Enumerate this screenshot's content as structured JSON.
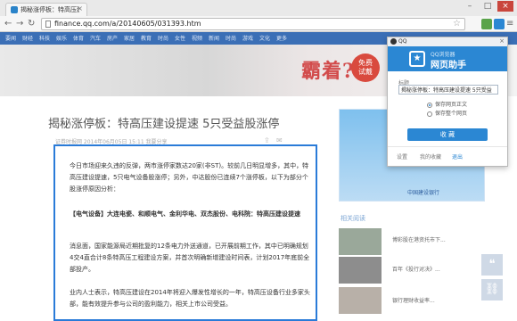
{
  "browser": {
    "tab_title": "揭秘涨停板：特高压建设...",
    "tab_close": "×",
    "url": "finance.qq.com/a/20140605/031393.htm",
    "win_min": "–",
    "win_max": "□",
    "win_close": "×"
  },
  "site_nav": [
    "要闻",
    "财经",
    "科技",
    "娱乐",
    "体育",
    "汽车",
    "房产",
    "家居",
    "教育",
    "时尚",
    "女性",
    "视频",
    "新闻",
    "时尚",
    "游戏",
    "文化",
    "更多"
  ],
  "banner": {
    "ad_text": "霸着?",
    "badge": "免费\n试戴"
  },
  "article": {
    "title": "揭秘涨停板：特高压建设提速 5只受益股涨停",
    "meta": "证券时报网  2014年06月05日 15:11  我要分享",
    "paragraphs": [
      "今日市场迎来久违的反弹，两市涨停家数达20家(非ST)。较前几日明显增多，其中，特高压建设提速，5只电气设备股涨停；另外，中达股份已连续7个涨停板，以下为部分个股涨停原因分析：",
      "【电气设备】大连电瓷、和顺电气、金利华电、双杰股份、电科院：特高压建设提速",
      "消息面，国家能源局近期批复的12条电力外送通道，已开展前期工作，其中已明确规划4交4直合计8条特高压工程建设方案，并首次明确新增建设时间表，计划2017年底前全部投产。",
      "业内人士表示，特高压建设在2014年将迎入爆发性增长的一年，特高压设备行业多家头部，能有效提升参与公司的盈利能力，相关上市公司受益。"
    ]
  },
  "sidebar": {
    "ad_bank": "中国建设银行",
    "section_head": "相关阅读",
    "items": [
      "博彩股在港资托市下...",
      "百年《投行对决》...",
      "银行理财收益率..."
    ]
  },
  "float_buttons": [
    "speech-icon",
    "link-icon"
  ],
  "popup": {
    "account": "QQ",
    "close": "×",
    "brand_small": "QQ浏览器",
    "brand_big": "网页助手",
    "title_label": "标题",
    "title_value": "揭秘涨停板：特高压建设提速 5只受益",
    "option_1": "保存网页正文",
    "option_2": "保存整个网页",
    "collect_button": "收 藏",
    "footer_settings": "设置",
    "footer_favorites": "我的收藏",
    "footer_logout": "退出"
  },
  "colors": {
    "accent": "#2b87d3",
    "selection_border": "#2a7bd8",
    "site_nav": "#3b6fb6"
  }
}
